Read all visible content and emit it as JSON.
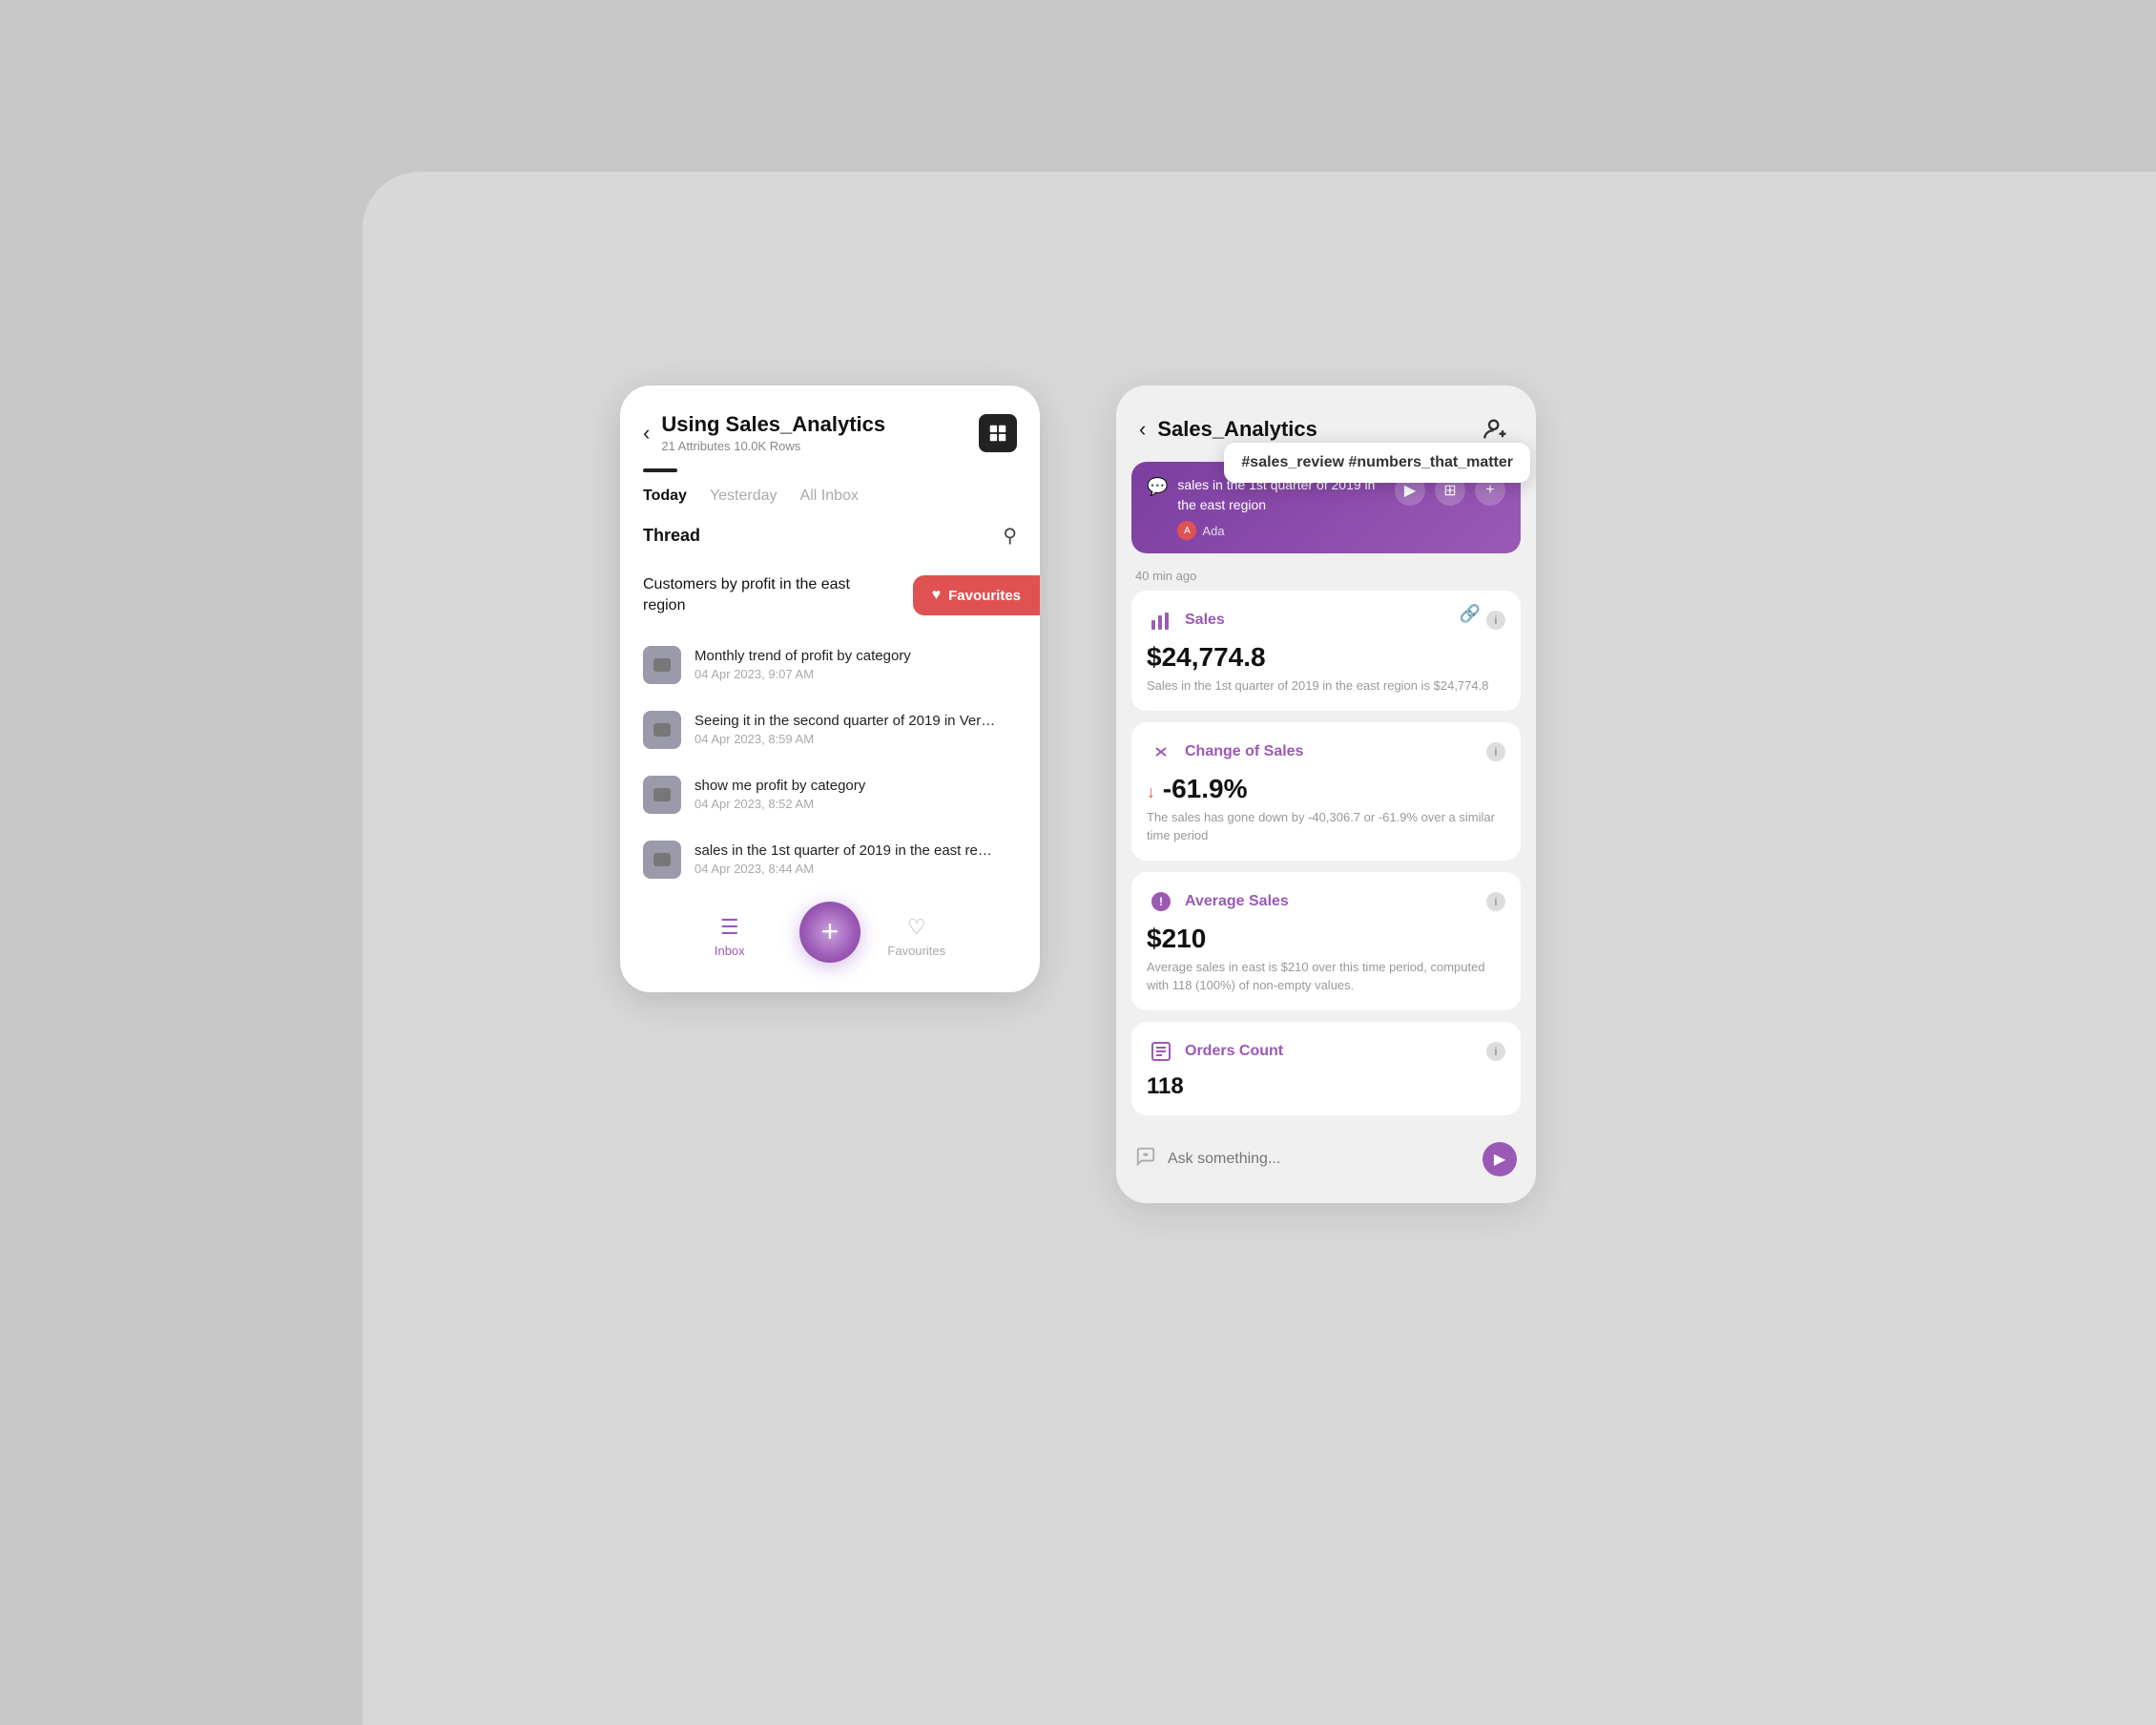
{
  "left": {
    "back_icon": "‹",
    "title": "Using Sales_Analytics",
    "subtitle": "21 Attributes 10.0K Rows",
    "header_icon": "⊞",
    "tabs": [
      "Today",
      "Yesterday",
      "All Inbox"
    ],
    "active_tab": "Today",
    "thread_label": "Thread",
    "highlighted_thread": "Customers by profit in the east region",
    "favourites_btn": "Favourites",
    "thread_items": [
      {
        "name": "Monthly trend of profit by category",
        "date": "04 Apr 2023,  9:07 AM"
      },
      {
        "name": "Seeing it in the second quarter of 2019 in Ver…",
        "date": "04 Apr 2023,  8:59 AM"
      },
      {
        "name": "show me profit by category",
        "date": "04 Apr 2023,  8:52 AM"
      },
      {
        "name": "sales in the 1st quarter of 2019 in the east re…",
        "date": "04 Apr 2023,  8:44 AM"
      }
    ],
    "nav": {
      "inbox_label": "Inbox",
      "favourites_label": "Favourites",
      "fab_icon": "+"
    }
  },
  "right": {
    "back_icon": "‹",
    "title": "Sales_Analytics",
    "user_icon": "👤+",
    "chat_bubble": {
      "text": "sales in the 1st quarter of 2019 in the east region",
      "hashtags": "#sales_review #numbers_that_matter",
      "ada_text": "Ada"
    },
    "time_ago": "40 min ago",
    "cards": [
      {
        "id": "sales",
        "icon": "📊",
        "title": "Sales",
        "value": "$24,774.8",
        "desc": "Sales in the 1st quarter of 2019 in the east region is $24,774.8",
        "has_link": true
      },
      {
        "id": "change_of_sales",
        "icon": "⇄",
        "title": "Change of Sales",
        "value": "-61.9%",
        "value_prefix": "↓",
        "desc": "The sales has gone down by -40,306.7 or -61.9% over a similar time period",
        "has_link": false
      },
      {
        "id": "average_sales",
        "icon": "⚠",
        "title": "Average Sales",
        "value": "$210",
        "desc": "Average sales in east is $210 over this time period, computed with 118 (100%) of non-empty values.",
        "has_link": false
      },
      {
        "id": "orders_count",
        "icon": "☰",
        "title": "Orders Count",
        "value_partial": "118",
        "desc": "",
        "has_link": false
      }
    ],
    "ask_placeholder": "Ask something...",
    "send_icon": "▶"
  }
}
